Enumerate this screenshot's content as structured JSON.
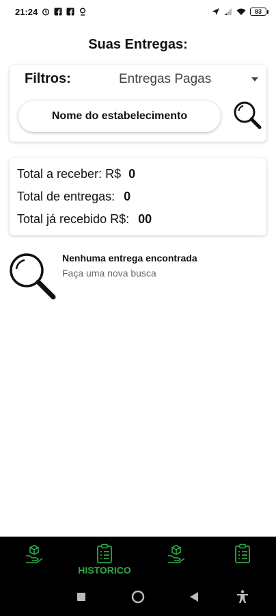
{
  "status_bar": {
    "time": "21:24",
    "battery": "83"
  },
  "page": {
    "title": "Suas Entregas:"
  },
  "filters": {
    "label": "Filtros:",
    "selected_option": "Entregas Pagas",
    "search_placeholder": "Nome do estabelecimento"
  },
  "summary": {
    "total_receive_label": "Total a receber: R$",
    "total_receive_value": "0",
    "total_deliveries_label": "Total de entregas:",
    "total_deliveries_value": "0",
    "total_received_label": "Total já recebido R$:",
    "total_received_value": "00"
  },
  "empty_state": {
    "title": "Nenhuma entrega encontrada",
    "subtitle": "Faça uma nova busca"
  },
  "bottom_nav": {
    "items": [
      {
        "icon": "package-hand-icon",
        "label": ""
      },
      {
        "icon": "clipboard-list-icon",
        "label": "HISTORICO"
      },
      {
        "icon": "package-hand-icon",
        "label": ""
      },
      {
        "icon": "clipboard-list-icon",
        "label": ""
      }
    ],
    "accent_color": "#2ea84a"
  },
  "system_nav": {
    "icons": [
      "square-icon",
      "circle-icon",
      "back-triangle-icon",
      "accessibility-icon"
    ]
  }
}
